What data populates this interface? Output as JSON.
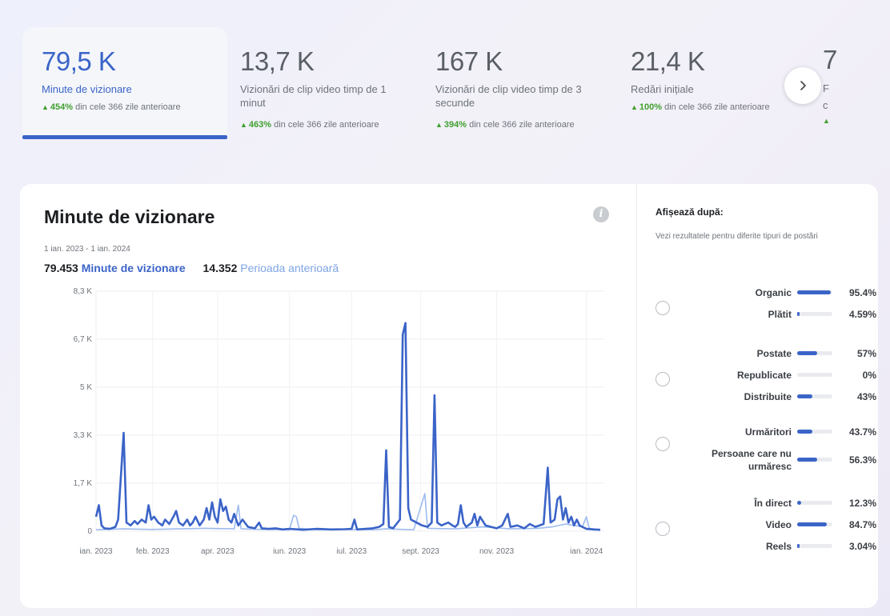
{
  "metrics": [
    {
      "value": "79,5 K",
      "label": "Minute de vizionare",
      "change_pct": "454%",
      "change_text": " din cele 366 zile anterioare"
    },
    {
      "value": "13,7 K",
      "label": "Vizionări de clip video timp de 1 minut",
      "change_pct": "463%",
      "change_text": " din cele 366 zile anterioare"
    },
    {
      "value": "167 K",
      "label": "Vizionări de clip video timp de 3 secunde",
      "change_pct": "394%",
      "change_text": " din cele 366 zile anterioare"
    },
    {
      "value": "21,4 K",
      "label": "Redări inițiale",
      "change_pct": "100%",
      "change_text": " din cele 366 zile anterioare"
    }
  ],
  "partial_metric": {
    "value": "7",
    "label1": "F",
    "label2": "c"
  },
  "chart_card": {
    "title": "Minute de vizionare",
    "date_range": "1 ian. 2023 - 1 ian. 2024",
    "total_current": "79.453",
    "total_current_label": "Minute de vizionare",
    "total_previous": "14.352",
    "total_previous_label": "Perioada anterioară"
  },
  "chart_data": {
    "type": "line",
    "y_ticks": [
      "0",
      "1,7 K",
      "3,3 K",
      "5 K",
      "6,7 K",
      "8,3 K"
    ],
    "ylim": [
      0,
      8300
    ],
    "x_ticks": [
      "ian. 2023",
      "feb. 2023",
      "apr. 2023",
      "iun. 2023",
      "iul. 2023",
      "sept. 2023",
      "nov. 2023",
      "ian. 2024"
    ],
    "series": [
      {
        "name": "Minute de vizionare",
        "color": "#3b64c8",
        "points": [
          [
            0,
            500
          ],
          [
            2,
            900
          ],
          [
            4,
            200
          ],
          [
            6,
            100
          ],
          [
            10,
            80
          ],
          [
            14,
            150
          ],
          [
            16,
            400
          ],
          [
            20,
            3400
          ],
          [
            22,
            300
          ],
          [
            25,
            200
          ],
          [
            28,
            350
          ],
          [
            30,
            250
          ],
          [
            33,
            400
          ],
          [
            36,
            300
          ],
          [
            38,
            900
          ],
          [
            40,
            400
          ],
          [
            42,
            500
          ],
          [
            45,
            300
          ],
          [
            48,
            200
          ],
          [
            50,
            400
          ],
          [
            53,
            250
          ],
          [
            56,
            500
          ],
          [
            58,
            700
          ],
          [
            60,
            300
          ],
          [
            63,
            200
          ],
          [
            66,
            400
          ],
          [
            68,
            200
          ],
          [
            70,
            300
          ],
          [
            72,
            500
          ],
          [
            75,
            200
          ],
          [
            78,
            400
          ],
          [
            80,
            800
          ],
          [
            82,
            400
          ],
          [
            84,
            1000
          ],
          [
            86,
            500
          ],
          [
            88,
            300
          ],
          [
            90,
            1100
          ],
          [
            92,
            700
          ],
          [
            94,
            850
          ],
          [
            96,
            400
          ],
          [
            98,
            300
          ],
          [
            100,
            600
          ],
          [
            103,
            200
          ],
          [
            106,
            400
          ],
          [
            110,
            150
          ],
          [
            115,
            100
          ],
          [
            118,
            300
          ],
          [
            120,
            100
          ],
          [
            125,
            80
          ],
          [
            130,
            100
          ],
          [
            135,
            60
          ],
          [
            140,
            80
          ],
          [
            150,
            50
          ],
          [
            160,
            80
          ],
          [
            170,
            60
          ],
          [
            180,
            70
          ],
          [
            185,
            80
          ],
          [
            187,
            400
          ],
          [
            189,
            60
          ],
          [
            195,
            80
          ],
          [
            200,
            100
          ],
          [
            205,
            150
          ],
          [
            208,
            250
          ],
          [
            210,
            2800
          ],
          [
            212,
            150
          ],
          [
            215,
            100
          ],
          [
            220,
            400
          ],
          [
            222,
            6800
          ],
          [
            224,
            7200
          ],
          [
            226,
            800
          ],
          [
            228,
            400
          ],
          [
            232,
            300
          ],
          [
            236,
            200
          ],
          [
            240,
            150
          ],
          [
            243,
            300
          ],
          [
            245,
            4700
          ],
          [
            247,
            300
          ],
          [
            250,
            200
          ],
          [
            255,
            300
          ],
          [
            258,
            200
          ],
          [
            260,
            150
          ],
          [
            262,
            250
          ],
          [
            264,
            900
          ],
          [
            266,
            300
          ],
          [
            268,
            150
          ],
          [
            272,
            300
          ],
          [
            274,
            600
          ],
          [
            276,
            200
          ],
          [
            278,
            500
          ],
          [
            282,
            200
          ],
          [
            286,
            150
          ],
          [
            290,
            100
          ],
          [
            294,
            200
          ],
          [
            298,
            600
          ],
          [
            300,
            150
          ],
          [
            305,
            200
          ],
          [
            310,
            100
          ],
          [
            314,
            250
          ],
          [
            318,
            150
          ],
          [
            324,
            250
          ],
          [
            327,
            2200
          ],
          [
            329,
            300
          ],
          [
            332,
            400
          ],
          [
            334,
            1100
          ],
          [
            336,
            1200
          ],
          [
            338,
            400
          ],
          [
            340,
            800
          ],
          [
            342,
            300
          ],
          [
            344,
            500
          ],
          [
            346,
            200
          ],
          [
            348,
            400
          ],
          [
            350,
            200
          ],
          [
            352,
            150
          ],
          [
            355,
            80
          ],
          [
            360,
            60
          ],
          [
            365,
            50
          ]
        ]
      },
      {
        "name": "Perioada anterioară",
        "color": "#9dbbee",
        "points": [
          [
            0,
            50
          ],
          [
            20,
            80
          ],
          [
            40,
            60
          ],
          [
            60,
            80
          ],
          [
            80,
            100
          ],
          [
            100,
            80
          ],
          [
            103,
            900
          ],
          [
            105,
            80
          ],
          [
            120,
            60
          ],
          [
            140,
            50
          ],
          [
            143,
            550
          ],
          [
            145,
            500
          ],
          [
            147,
            100
          ],
          [
            160,
            50
          ],
          [
            180,
            60
          ],
          [
            200,
            50
          ],
          [
            210,
            80
          ],
          [
            230,
            50
          ],
          [
            238,
            1300
          ],
          [
            240,
            100
          ],
          [
            260,
            80
          ],
          [
            280,
            150
          ],
          [
            300,
            80
          ],
          [
            320,
            100
          ],
          [
            330,
            150
          ],
          [
            340,
            250
          ],
          [
            352,
            150
          ],
          [
            355,
            500
          ],
          [
            357,
            100
          ],
          [
            365,
            50
          ]
        ]
      }
    ]
  },
  "side": {
    "title": "Afișează după:",
    "subtitle": "Vezi rezultatele pentru diferite tipuri de postări",
    "groups": [
      {
        "rows": [
          {
            "label": "Organic",
            "pct": "95.4%",
            "value": 95.4
          },
          {
            "label": "Plătit",
            "pct": "4.59%",
            "value": 4.59
          }
        ]
      },
      {
        "rows": [
          {
            "label": "Postate",
            "pct": "57%",
            "value": 57
          },
          {
            "label": "Republicate",
            "pct": "0%",
            "value": 0
          },
          {
            "label": "Distribuite",
            "pct": "43%",
            "value": 43
          }
        ]
      },
      {
        "rows": [
          {
            "label": "Urmăritori",
            "pct": "43.7%",
            "value": 43.7
          },
          {
            "label": "Persoane care nu urmăresc",
            "pct": "56.3%",
            "value": 56.3
          }
        ]
      },
      {
        "rows": [
          {
            "label": "În direct",
            "pct": "12.3%",
            "value": 12.3
          },
          {
            "label": "Video",
            "pct": "84.7%",
            "value": 84.7
          },
          {
            "label": "Reels",
            "pct": "3.04%",
            "value": 3.04
          }
        ]
      }
    ]
  },
  "colors": {
    "accent": "#3b64c8",
    "accent_light": "#9dbbee",
    "positive": "#3f9f2e"
  },
  "icons": {
    "next": "chevron-right-icon",
    "info": "info-icon",
    "trend": "triangle-up-icon"
  }
}
